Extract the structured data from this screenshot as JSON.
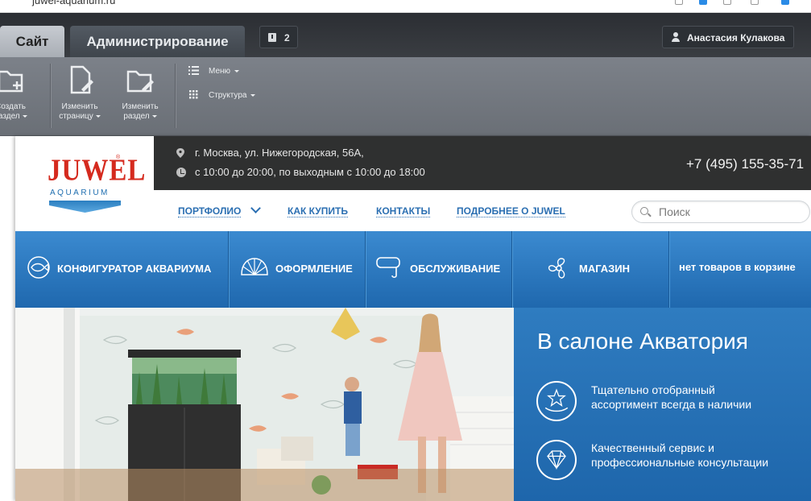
{
  "browser": {
    "url": "juwel-aquarium.ru"
  },
  "admin": {
    "tab_site": "Сайт",
    "tab_admin": "Администрирование",
    "notifications_count": "2",
    "user_name": "Анастасия Кулакова",
    "tools": [
      {
        "label_line1": "Создать",
        "label_line2": "раздел",
        "icon": "folder-plus-icon"
      },
      {
        "label_line1": "Изменить",
        "label_line2": "страницу",
        "icon": "page-edit-icon"
      },
      {
        "label_line1": "Изменить",
        "label_line2": "раздел",
        "icon": "folder-edit-icon"
      }
    ],
    "menu_label": "Меню",
    "structure_label": "Структура"
  },
  "site": {
    "logo_main": "JUWEL",
    "logo_sub": "AQUARIUM",
    "address": "г. Москва, ул. Нижегородская, 56А,",
    "hours": "с 10:00 до 20:00, по выходным с 10:00 до 18:00",
    "phone": "+7 (495) 155-35-71",
    "nav": [
      "ПОРТФОЛИО",
      "КАК КУПИТЬ",
      "КОНТАКТЫ",
      "ПОДРОБНЕЕ О JUWEL"
    ],
    "search_placeholder": "Поиск",
    "categories": [
      {
        "label": "КОНФИГУРАТОР АКВАРИУМА",
        "icon": "fish-icon"
      },
      {
        "label": "ОФОРМЛЕНИЕ",
        "icon": "shell-icon"
      },
      {
        "label": "ОБСЛУЖИВАНИЕ",
        "icon": "diving-mask-icon"
      },
      {
        "label": "МАГАЗИН",
        "icon": "fan-icon"
      },
      {
        "label": "нет товаров в корзине",
        "icon": ""
      }
    ],
    "promo": {
      "title": "В салоне Акватория",
      "items": [
        {
          "text": "Тщательно отобранный ассортимент всегда в наличии",
          "icon": "starfish-hand-icon"
        },
        {
          "text": "Качественный сервис и профессиональные консультации",
          "icon": "diamond-icon"
        }
      ]
    }
  },
  "colors": {
    "brand_red": "#d52a1e",
    "brand_blue": "#2b6fb2",
    "category_bar": "#2a78c0",
    "dark_bar": "#2f3030"
  }
}
